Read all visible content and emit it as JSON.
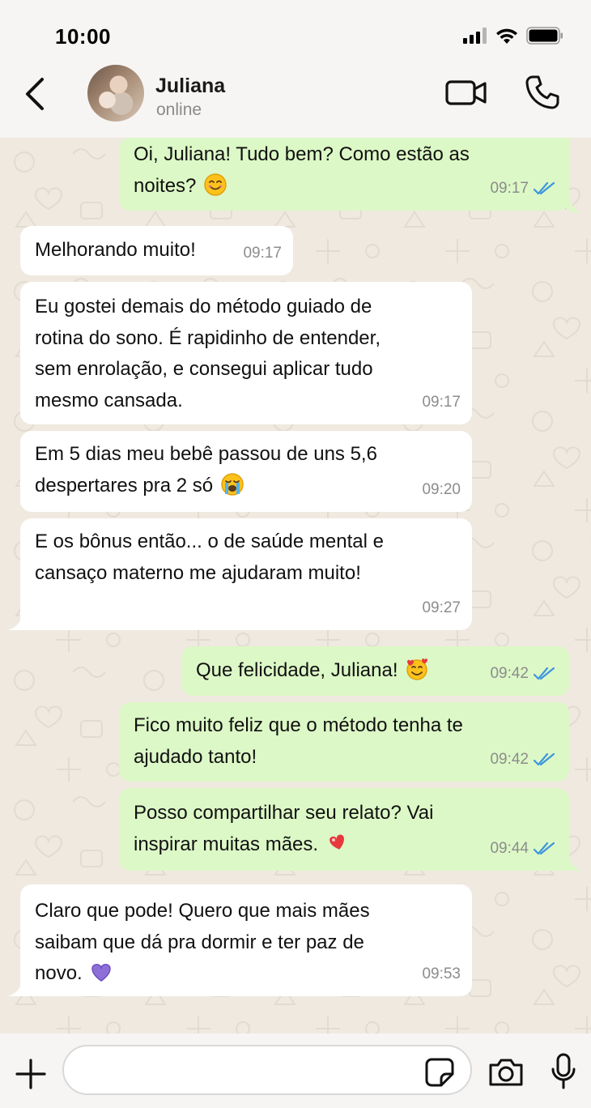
{
  "status_bar": {
    "time": "10:00"
  },
  "header": {
    "contact_name": "Juliana",
    "contact_status": "online"
  },
  "messages": [
    {
      "direction": "out",
      "lines": [
        "Oi, Juliana! Tudo bem? Como estão as",
        "noites?"
      ],
      "emoji": "smiling-face",
      "time": "09:17",
      "read": true
    },
    {
      "direction": "in",
      "lines": [
        "Melhorando muito!"
      ],
      "time": "09:17"
    },
    {
      "direction": "in",
      "lines": [
        "Eu gostei demais do método guiado de",
        "rotina do sono. É rapidinho de entender,",
        "sem enrolação, e consegui aplicar tudo",
        "mesmo cansada."
      ],
      "time": "09:17"
    },
    {
      "direction": "in",
      "lines": [
        "Em 5 dias meu bebê passou de uns 5,6",
        "despertares pra 2 só"
      ],
      "emoji": "crying-face",
      "time": "09:20"
    },
    {
      "direction": "in",
      "lines": [
        "E os bônus então... o de saúde mental e",
        "cansaço materno me ajudaram muito!"
      ],
      "time": "09:27"
    },
    {
      "direction": "out",
      "lines": [
        "Que felicidade, Juliana!"
      ],
      "emoji": "smiling-face-with-hearts",
      "time": "09:42",
      "read": true
    },
    {
      "direction": "out",
      "lines": [
        "Fico muito feliz que o método tenha te",
        "ajudado tanto!"
      ],
      "time": "09:42",
      "read": true
    },
    {
      "direction": "out",
      "lines": [
        "Posso compartilhar seu relato? Vai",
        "inspirar muitas mães."
      ],
      "emoji": "heart-exclamation",
      "time": "09:44",
      "read": true
    },
    {
      "direction": "in",
      "lines": [
        "Claro que pode! Quero que mais mães",
        "saibam que dá pra dormir e ter paz de",
        "novo."
      ],
      "emoji": "purple-heart",
      "time": "09:53"
    }
  ],
  "input": {
    "placeholder": ""
  },
  "colors": {
    "outgoing_bubble": "#dcf8c6",
    "incoming_bubble": "#ffffff",
    "read_ticks": "#3e95de",
    "chat_background": "#efe9e0"
  }
}
